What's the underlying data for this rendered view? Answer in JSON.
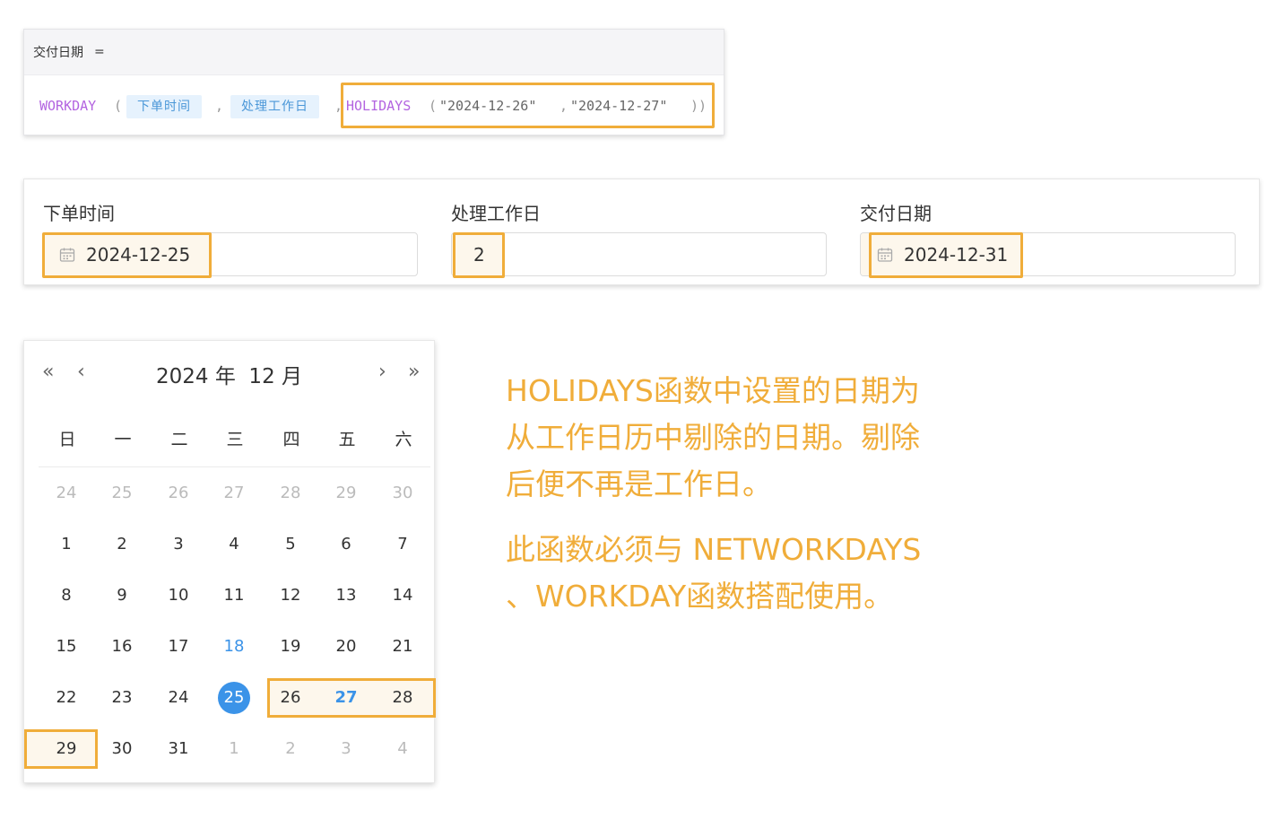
{
  "formula": {
    "field_name": "交付日期",
    "equals": "=",
    "fn_workday": "WORKDAY",
    "open1": "(",
    "arg_order_time": "下单时间",
    "comma1": ",",
    "arg_work_days": "处理工作日",
    "comma2": ",",
    "fn_holidays": "HOLIDAYS",
    "open2": "(",
    "holiday1": "\"2024-12-26\"",
    "comma3": ",",
    "holiday2": "\"2024-12-27\"",
    "close": "))"
  },
  "fields": [
    {
      "label": "下单时间",
      "value": "2024-12-25",
      "icon": "calendar-icon"
    },
    {
      "label": "处理工作日",
      "value": "2"
    },
    {
      "label": "交付日期",
      "value": "2024-12-31",
      "icon": "calendar-icon"
    }
  ],
  "calendar": {
    "nav": {
      "prev_year": "«",
      "prev_month": "‹",
      "next_month": "›",
      "next_year": "»"
    },
    "title": "2024 年  12 月",
    "weekdays": [
      "日",
      "一",
      "二",
      "三",
      "四",
      "五",
      "六"
    ],
    "weeks": [
      [
        "24",
        "25",
        "26",
        "27",
        "28",
        "29",
        "30"
      ],
      [
        "1",
        "2",
        "3",
        "4",
        "5",
        "6",
        "7"
      ],
      [
        "8",
        "9",
        "10",
        "11",
        "12",
        "13",
        "14"
      ],
      [
        "15",
        "16",
        "17",
        "18",
        "19",
        "20",
        "21"
      ],
      [
        "22",
        "23",
        "24",
        "25",
        "26",
        "27",
        "28"
      ],
      [
        "29",
        "30",
        "31",
        "1",
        "2",
        "3",
        "4"
      ]
    ],
    "today": "18",
    "selected": "25",
    "highlighted": [
      "26",
      "27",
      "28",
      "29"
    ],
    "accent_color": "#3b93e8"
  },
  "note": {
    "lines": [
      "HOLIDAYS函数中设置的日期为",
      "从工作日历中剔除的日期。剔除",
      "后便不再是工作日。",
      "此函数必须与 NETWORKDAYS",
      "、WORKDAY函数搭配使用。"
    ],
    "color": "#f0ad3a"
  },
  "highlight_color": "#f0ad3a"
}
